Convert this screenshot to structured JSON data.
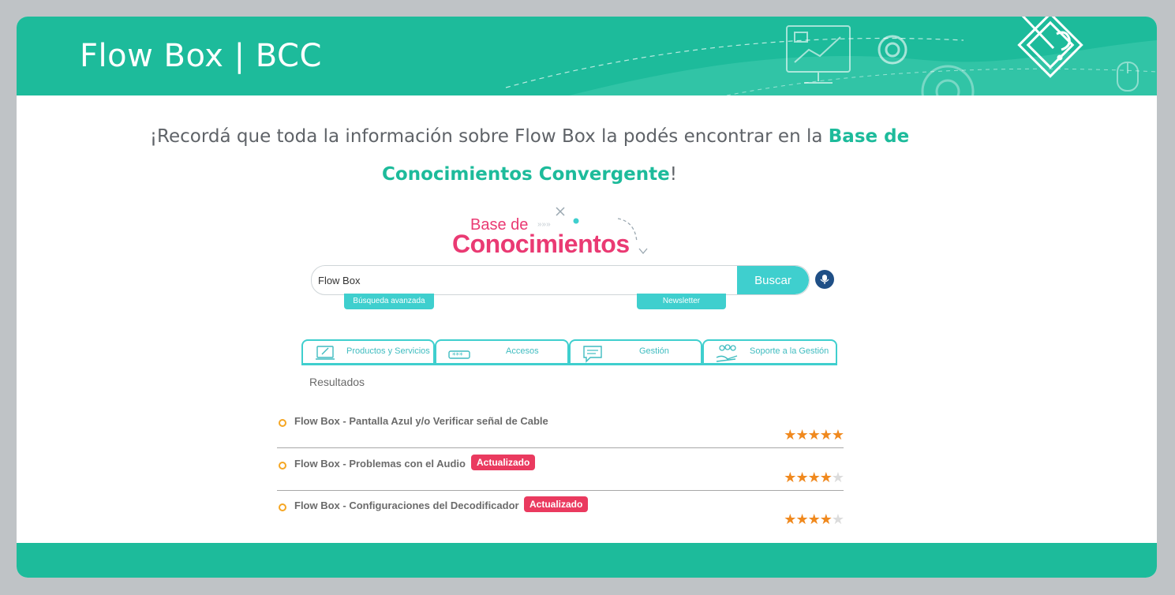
{
  "header": {
    "title": "Flow Box | BCC"
  },
  "intro": {
    "text_before": "¡Recordá que toda la información sobre Flow Box la podés encontrar en la ",
    "highlight": "Base de Conocimientos Convergente",
    "text_after": "!"
  },
  "kb_logo": {
    "line1": "Base de",
    "line2": "Conocimientos"
  },
  "search": {
    "value": "Flow Box",
    "button_label": "Buscar",
    "advanced_label": "Búsqueda avanzada",
    "newsletter_label": "Newsletter"
  },
  "tabs": [
    {
      "label": "Productos y Servicios",
      "icon": "devices-icon"
    },
    {
      "label": "Accesos",
      "icon": "password-icon"
    },
    {
      "label": "Gestión",
      "icon": "chat-icon"
    },
    {
      "label": "Soporte a la Gestión",
      "icon": "team-hand-icon"
    }
  ],
  "results_label": "Resultados",
  "results": [
    {
      "title": "Flow Box - Pantalla Azul y/o Verificar señal de Cable",
      "badge": "",
      "rating": 5
    },
    {
      "title": "Flow Box - Problemas con el Audio",
      "badge": "Actualizado",
      "rating": 4
    },
    {
      "title": "Flow Box - Configuraciones del Decodificador",
      "badge": "Actualizado",
      "rating": 4
    }
  ],
  "colors": {
    "brand_green": "#1dbb9b",
    "search_cyan": "#3fcfce",
    "logo_pink": "#ea3a73",
    "badge_red": "#ea3a5f",
    "star_orange": "#f0891e",
    "mic_blue": "#1f4f86"
  }
}
